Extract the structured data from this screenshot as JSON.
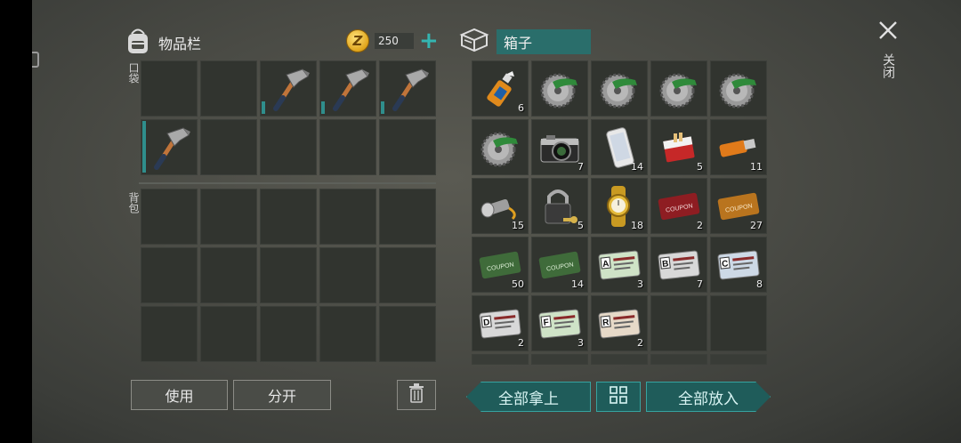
{
  "inventory": {
    "title": "物品栏",
    "currency_icon": "gold-coin-icon",
    "currency_value": "250",
    "add_currency_label": "+",
    "pocket_label": "口袋",
    "backpack_label": "背包",
    "pocket_slots": [
      {
        "item": "",
        "qty": ""
      },
      {
        "item": "",
        "qty": ""
      },
      {
        "item": "hammer",
        "qty": ""
      },
      {
        "item": "hammer",
        "qty": ""
      },
      {
        "item": "hammer",
        "qty": ""
      },
      {
        "item": "hammer",
        "qty": ""
      },
      {
        "item": "",
        "qty": ""
      },
      {
        "item": "",
        "qty": ""
      },
      {
        "item": "",
        "qty": ""
      },
      {
        "item": "",
        "qty": ""
      }
    ],
    "use_label": "使用",
    "split_label": "分开",
    "trash_icon": "trash-icon"
  },
  "box": {
    "title": "箱子",
    "slots": [
      {
        "item": "glue",
        "qty": "6"
      },
      {
        "item": "saw-blade",
        "qty": ""
      },
      {
        "item": "saw-blade",
        "qty": ""
      },
      {
        "item": "saw-blade",
        "qty": ""
      },
      {
        "item": "saw-blade",
        "qty": ""
      },
      {
        "item": "saw-blade",
        "qty": ""
      },
      {
        "item": "camera",
        "qty": "7"
      },
      {
        "item": "smartphone",
        "qty": "14"
      },
      {
        "item": "cigarettes",
        "qty": "5"
      },
      {
        "item": "usb-drive",
        "qty": "11"
      },
      {
        "item": "flashlight",
        "qty": "15"
      },
      {
        "item": "padlock",
        "qty": "5"
      },
      {
        "item": "gold-watch",
        "qty": "18"
      },
      {
        "item": "combat-coupon",
        "qty": "2"
      },
      {
        "item": "survival-coupon",
        "qty": "27"
      },
      {
        "item": "ration-coupon",
        "qty": "50"
      },
      {
        "item": "ration-coupon",
        "qty": "14"
      },
      {
        "item": "army-card-a",
        "qty": "3"
      },
      {
        "item": "army-card-b",
        "qty": "7"
      },
      {
        "item": "army-card-c",
        "qty": "8"
      },
      {
        "item": "army-card-d",
        "qty": "2"
      },
      {
        "item": "army-card-f",
        "qty": "3"
      },
      {
        "item": "army-card-r",
        "qty": "2"
      },
      {
        "item": "",
        "qty": ""
      },
      {
        "item": "",
        "qty": ""
      }
    ],
    "take_all_label": "全部拿上",
    "put_all_label": "全部放入",
    "sort_icon": "grid-sort-icon"
  },
  "close": {
    "label": "关闭",
    "icon": "close-x-icon"
  },
  "coupon_texts": {
    "ration": "RATION COUPON",
    "combat": "COMBAT GEAR COUPON",
    "survival": "SURVIVAL KIT COUPON",
    "army": "US ARMY",
    "card_a": "A",
    "card_b": "B",
    "card_c": "C",
    "card_d": "D",
    "card_f": "F",
    "card_r": "R"
  },
  "colors": {
    "accent_teal": "#2f8e8c",
    "slot_bg": "#31342f",
    "coin_gold": "#e0a51c",
    "ration_green": "#3f6b3a",
    "combat_red": "#8e1d22",
    "survival_orange": "#b9741e"
  }
}
